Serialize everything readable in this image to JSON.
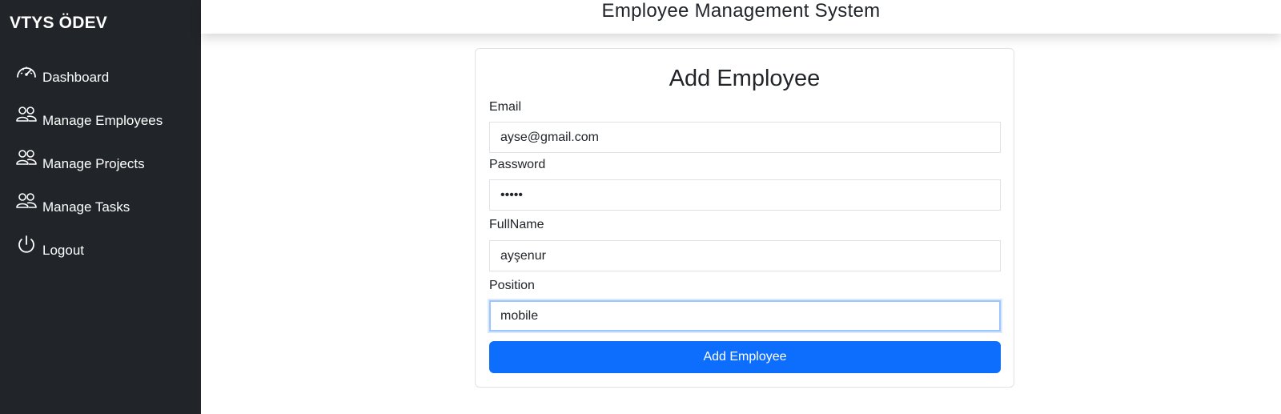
{
  "sidebar": {
    "brand": "VTYS ÖDEV",
    "items": [
      {
        "label": "Dashboard",
        "icon": "speedometer-icon"
      },
      {
        "label": "Manage Employees",
        "icon": "people-icon"
      },
      {
        "label": "Manage Projects",
        "icon": "people-icon"
      },
      {
        "label": "Manage Tasks",
        "icon": "people-icon"
      },
      {
        "label": "Logout",
        "icon": "power-icon"
      }
    ]
  },
  "header": {
    "title": "Employee Management System"
  },
  "form": {
    "title": "Add Employee",
    "email_label": "Email",
    "email_value": "ayse@gmail.com",
    "password_label": "Password",
    "password_value": "ayse1",
    "fullname_label": "FullName",
    "fullname_value": "ayşenur",
    "position_label": "Position",
    "position_value": "mobile",
    "submit_label": "Add Employee"
  },
  "colors": {
    "sidebar_bg": "#212529",
    "primary": "#0d6efd",
    "focus_ring": "#9ec5fe"
  }
}
